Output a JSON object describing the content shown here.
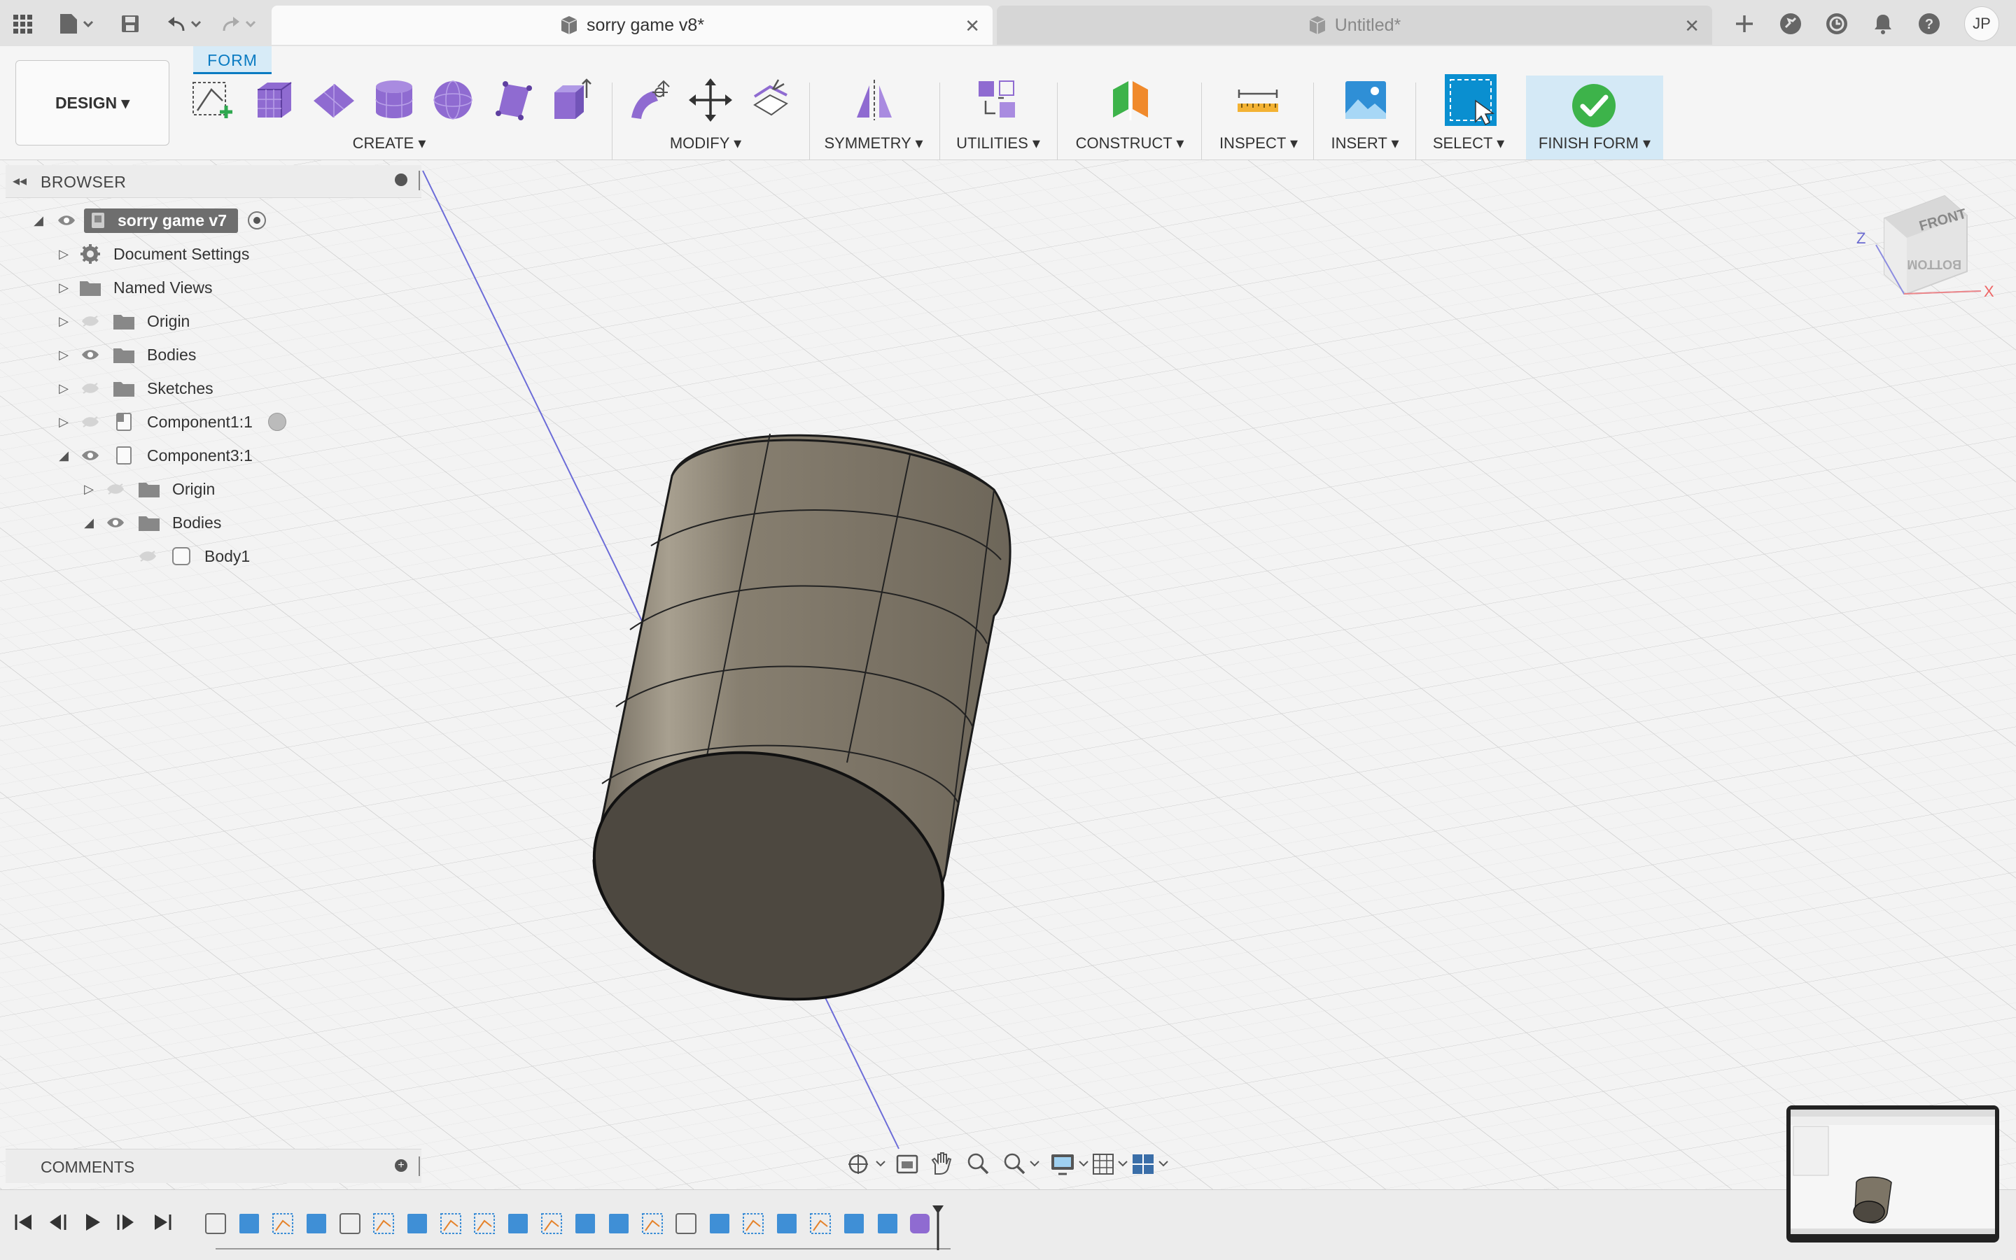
{
  "titlebar": {
    "tabs": [
      {
        "label": "sorry game v8*",
        "active": true
      },
      {
        "label": "Untitled*",
        "active": false
      }
    ],
    "user_initials": "JP"
  },
  "toolbar": {
    "workspace_button": "DESIGN ▾",
    "active_tab": "FORM",
    "groups": {
      "create": "CREATE ▾",
      "modify": "MODIFY ▾",
      "symmetry": "SYMMETRY ▾",
      "utilities": "UTILITIES ▾",
      "construct": "CONSTRUCT ▾",
      "inspect": "INSPECT ▾",
      "insert": "INSERT ▾",
      "select": "SELECT ▾",
      "finish": "FINISH FORM ▾"
    }
  },
  "browser": {
    "title": "BROWSER",
    "root": "sorry game v7",
    "items": [
      {
        "label": "Document Settings"
      },
      {
        "label": "Named Views"
      },
      {
        "label": "Origin"
      },
      {
        "label": "Bodies"
      },
      {
        "label": "Sketches"
      },
      {
        "label": "Component1:1"
      },
      {
        "label": "Component3:1"
      },
      {
        "label": "Origin"
      },
      {
        "label": "Bodies"
      },
      {
        "label": "Body1"
      }
    ]
  },
  "comments": {
    "title": "COMMENTS"
  },
  "viewcube": {
    "front": "FRONT",
    "bottom": "BOTTOM",
    "axis_x": "X",
    "axis_z": "Z"
  },
  "colors": {
    "accent": "#0a7bc2",
    "form_purple": "#8f6bd1",
    "finish_green": "#3db34a",
    "body_face": "#7d7566"
  }
}
